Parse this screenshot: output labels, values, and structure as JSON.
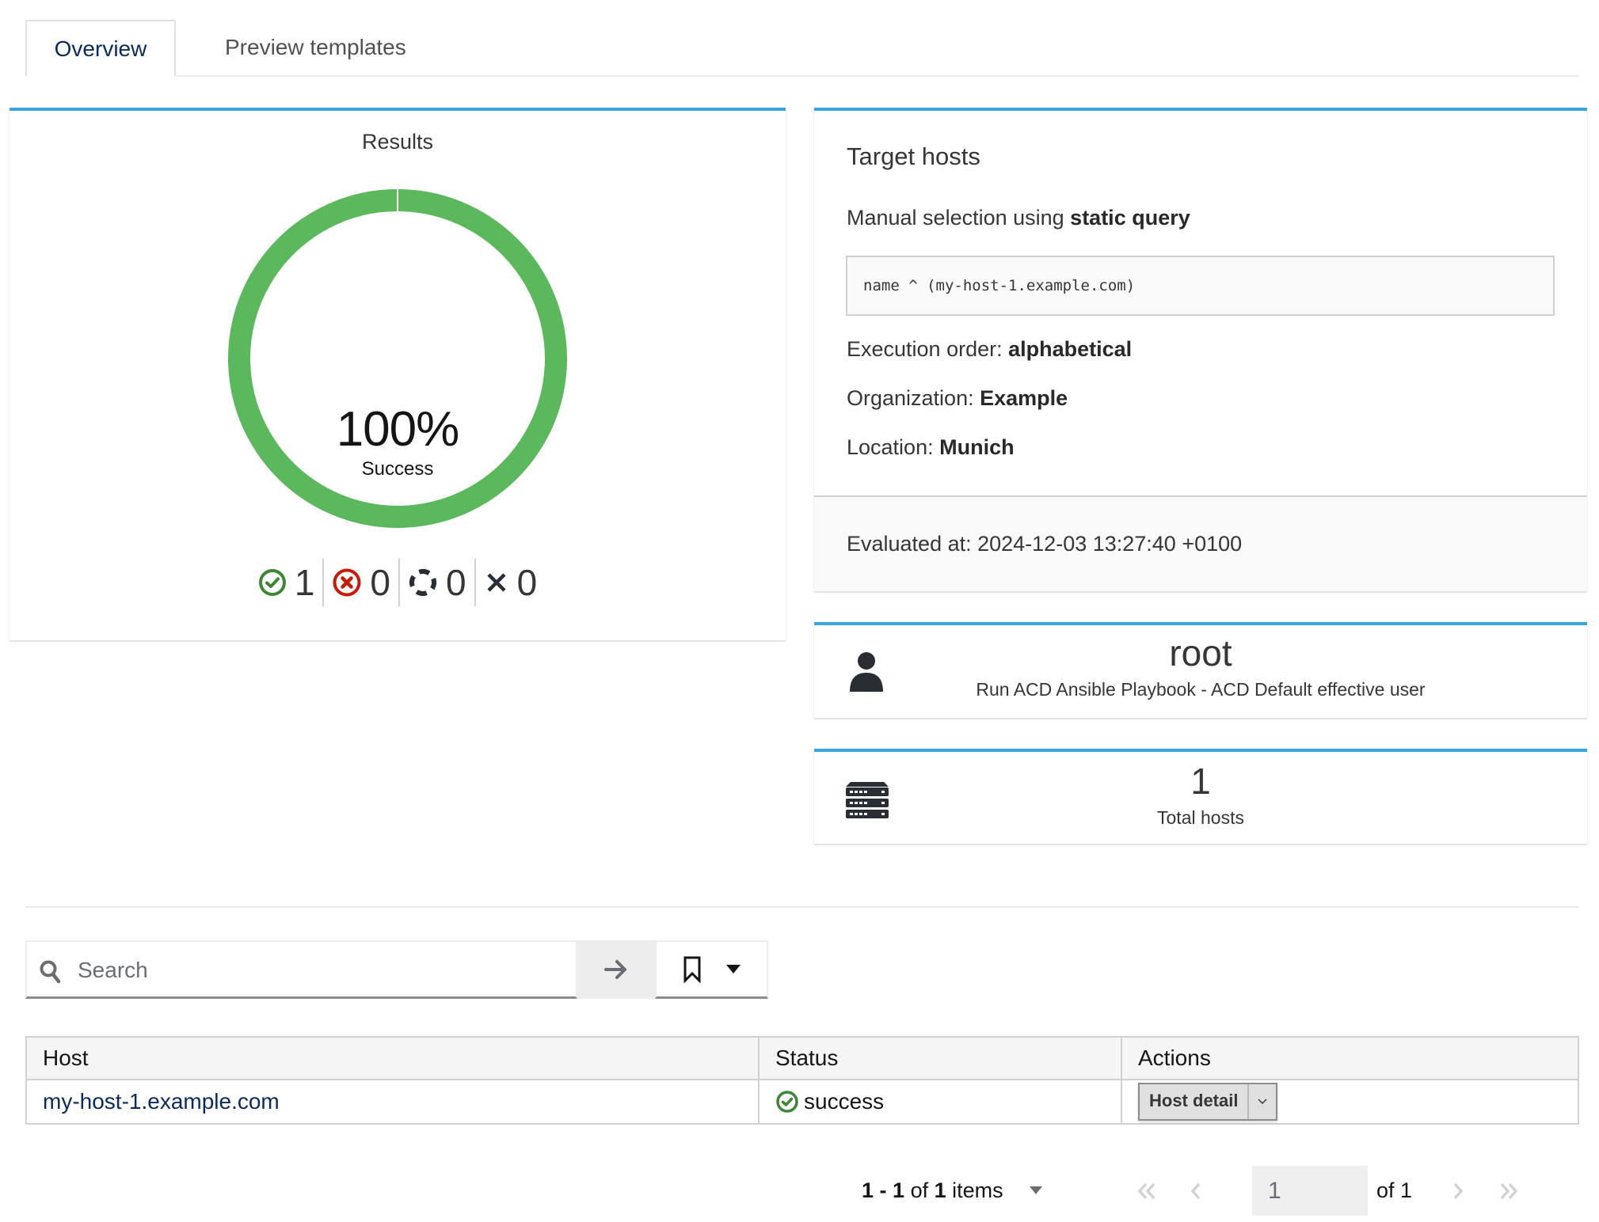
{
  "tabs": [
    {
      "label": "Overview",
      "active": true
    },
    {
      "label": "Preview templates",
      "active": false
    }
  ],
  "results": {
    "title": "Results",
    "percent_label": "100%",
    "percent_value": 100,
    "caption": "Success",
    "colors": {
      "success": "#5cb85c",
      "failed": "#cc0000",
      "pending": "#292e34",
      "cancelled": "#292e34"
    },
    "counts": [
      {
        "name": "success",
        "icon": "check-circle-icon",
        "value": "1"
      },
      {
        "name": "failed",
        "icon": "error-circle-icon",
        "value": "0"
      },
      {
        "name": "pending",
        "icon": "spinner-icon",
        "value": "0"
      },
      {
        "name": "cancelled",
        "icon": "times-icon",
        "value": "0"
      }
    ]
  },
  "target_hosts": {
    "title": "Target hosts",
    "manual_prefix": "Manual selection using ",
    "manual_bold": "static query",
    "query": "name ^ (my-host-1.example.com)",
    "execution_order_label": "Execution order: ",
    "execution_order_value": "alphabetical",
    "organization_label": "Organization: ",
    "organization_value": "Example",
    "location_label": "Location: ",
    "location_value": "Munich",
    "evaluated_at": "Evaluated at: 2024-12-03 13:27:40 +0100"
  },
  "effective_user": {
    "icon": "user-icon",
    "name": "root",
    "description": "Run ACD Ansible Playbook - ACD Default effective user"
  },
  "total_hosts": {
    "icon": "server-icon",
    "count": "1",
    "label": "Total hosts"
  },
  "search": {
    "placeholder": "Search",
    "value": ""
  },
  "table": {
    "columns": [
      "Host",
      "Status",
      "Actions"
    ],
    "rows": [
      {
        "host": "my-host-1.example.com",
        "status": "success",
        "action": "Host detail"
      }
    ]
  },
  "pagination": {
    "range_start": "1",
    "range_sep": " - ",
    "range_end": "1",
    "of_text": " of ",
    "total": "1",
    "items_text": " items",
    "current_page": "1",
    "of_pages": "of 1"
  }
}
